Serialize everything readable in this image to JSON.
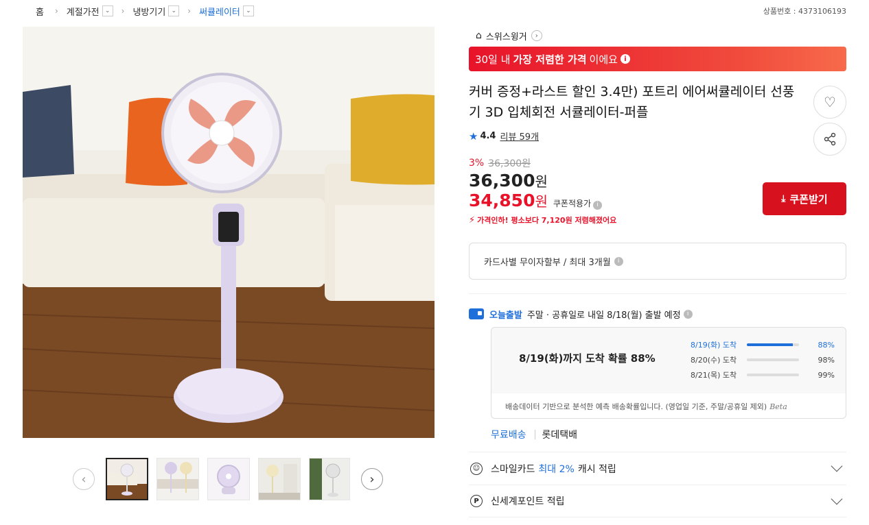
{
  "breadcrumb": {
    "items": [
      {
        "label": "홈"
      },
      {
        "label": "계절가전"
      },
      {
        "label": "냉방기기"
      },
      {
        "label": "써큘레이터"
      }
    ],
    "product_no": "상품번호 : 4373106193"
  },
  "store": {
    "name": "스위스윙거"
  },
  "banner": {
    "pre": "30일 내",
    "bold": "가장 저렴한 가격",
    "post": "이에요"
  },
  "product": {
    "title": "커버 증정+라스트 할인 3.4만) 포트리 에어써큘레이터 선풍기 3D 입체회전 서큘레이터-퍼플",
    "rating": "4.4",
    "reviews": "리뷰 59개"
  },
  "price": {
    "discount_pct": "3%",
    "original": "36,300원",
    "sale": "36,300",
    "coupon_price": "34,850",
    "won": "원",
    "coupon_caption": "쿠폰적용가",
    "drop_note": "가격인하! 평소보다 7,120원 저렴해졌어요",
    "coupon_button": "쿠폰받기"
  },
  "installment": {
    "text": "카드사별 무이자할부 / 최대 3개월"
  },
  "shipping": {
    "badge": "오늘출발",
    "text": "주말 · 공휴일로 내일 8/18(월) 출발 예정",
    "summary": "8/19(화)까지 도착 확률 88%",
    "rows": [
      {
        "date": "8/19(화) 도착",
        "prob": "88%",
        "fraction": 0.88
      },
      {
        "date": "8/20(수) 도착",
        "prob": "98%",
        "fraction": 0.98
      },
      {
        "date": "8/21(목) 도착",
        "prob": "99%",
        "fraction": 0.99
      }
    ],
    "note": "배송데이터 기반으로 분석한 예측 배송확률입니다. (영업일 기준, 주말/공휴일 제외)",
    "beta": "Beta",
    "free": "무료배송",
    "courier": "롯데택배"
  },
  "benefits": {
    "smile": {
      "pre": "스마일카드",
      "hl": "최대 2%",
      "post": "캐시 적립"
    },
    "ssg": {
      "label": "신세계포인트 적립"
    }
  },
  "colors": {
    "accent_red": "#e8132a",
    "accent_blue": "#1e6fd9"
  }
}
